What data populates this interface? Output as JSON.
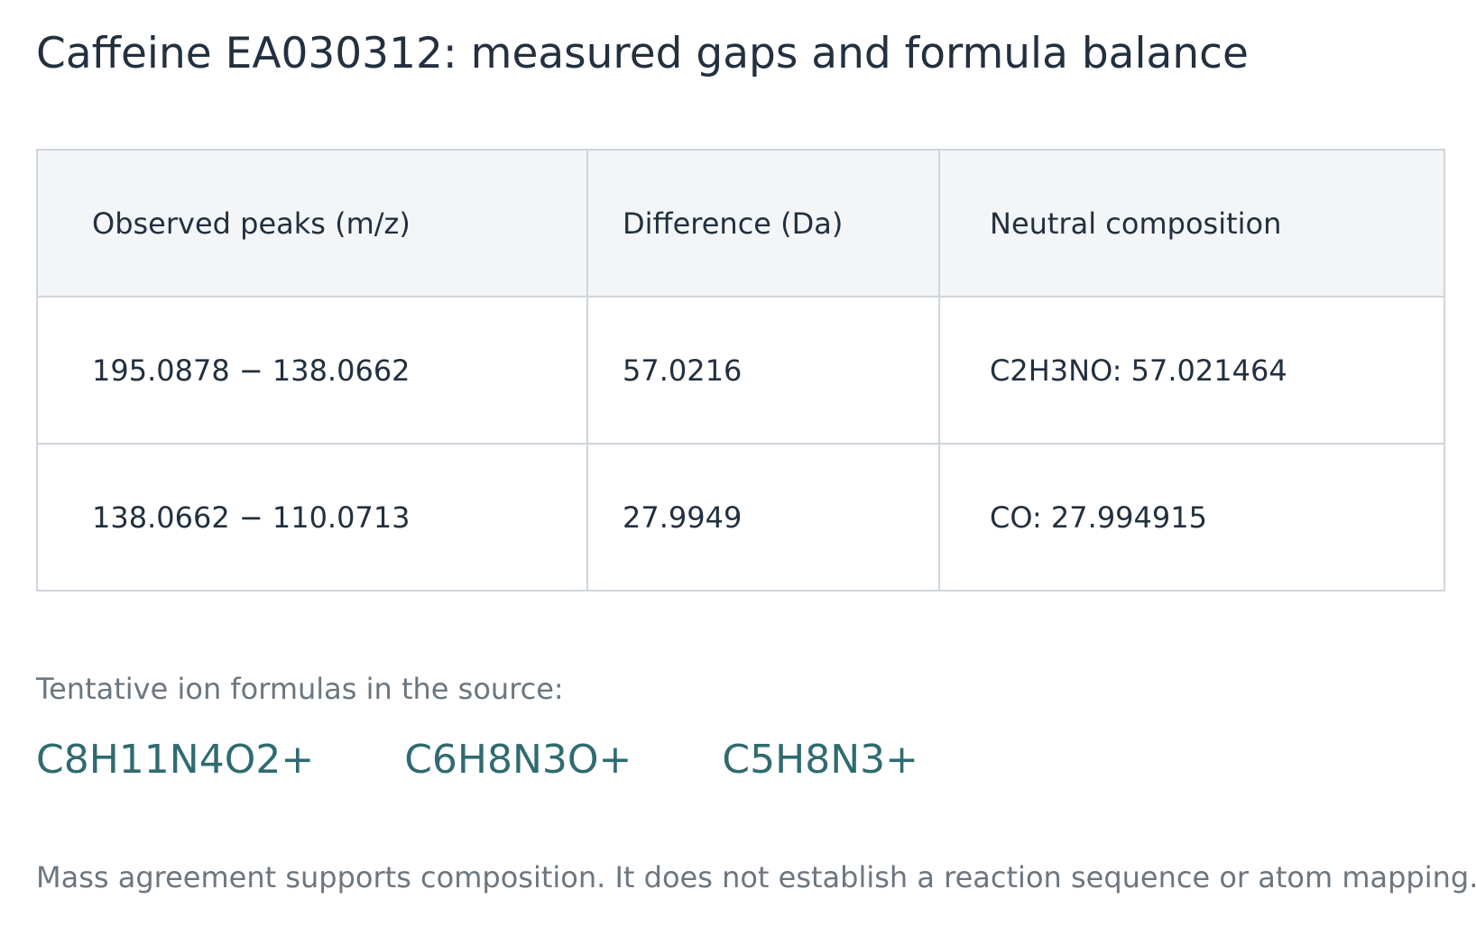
{
  "title": "Caffeine EA030312: measured gaps and formula balance",
  "table": {
    "headers": [
      "Observed peaks (m/z)",
      "Difference (Da)",
      "Neutral composition"
    ],
    "rows": [
      [
        "195.0878 − 138.0662",
        "57.0216",
        "C2H3NO: 57.021464"
      ],
      [
        "138.0662 − 110.0713",
        "27.9949",
        "CO: 27.994915"
      ]
    ]
  },
  "ions": {
    "label": "Tentative ion formulas in the source:",
    "formulas": [
      "C8H11N4O2+",
      "C6H8N3O+",
      "C5H8N3+"
    ]
  },
  "footnote": "Mass agreement supports composition. It does not establish a reaction sequence or atom mapping."
}
